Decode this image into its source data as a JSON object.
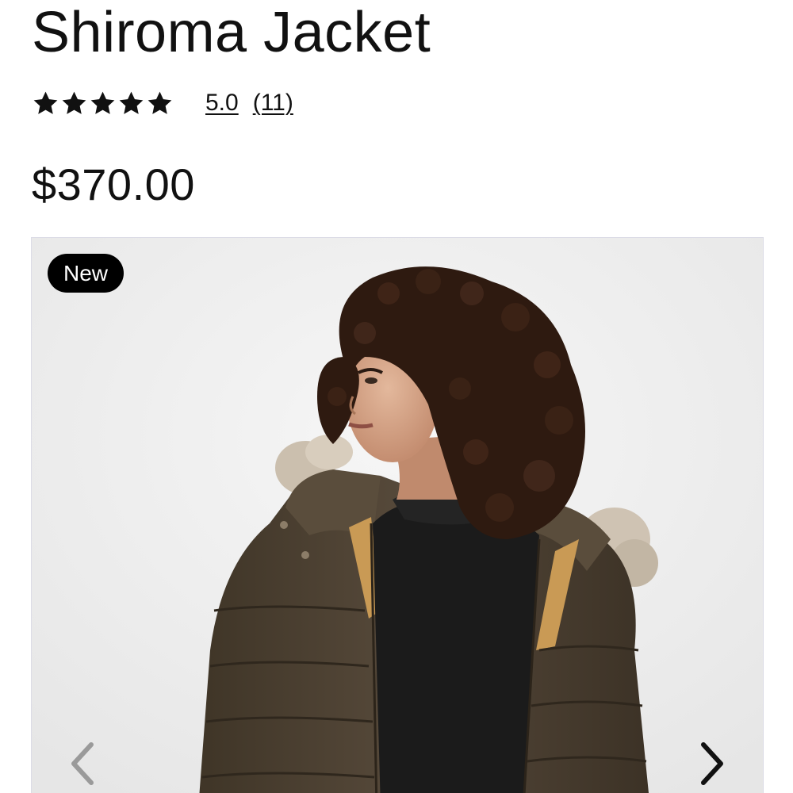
{
  "product": {
    "title": "Shiroma Jacket",
    "rating": {
      "stars": 5,
      "max_stars": 5,
      "value": "5.0",
      "review_count": "(11)"
    },
    "price": "$370.00"
  },
  "gallery": {
    "badge": "New",
    "image": "woman-in-brown-puffer-jacket-with-fur-hood",
    "prev_icon": "chevron-left-icon",
    "next_icon": "chevron-right-icon",
    "prev_disabled": true
  },
  "colors": {
    "text": "#111111",
    "badge_bg": "#000000",
    "badge_text": "#ffffff",
    "jacket": "#4e4231",
    "lining": "#c99a55",
    "turtleneck": "#1b1b1b",
    "hair": "#2e1a10",
    "background": "#eeeeee",
    "arrow_disabled": "#9a9a9a",
    "arrow_enabled": "#111111"
  }
}
